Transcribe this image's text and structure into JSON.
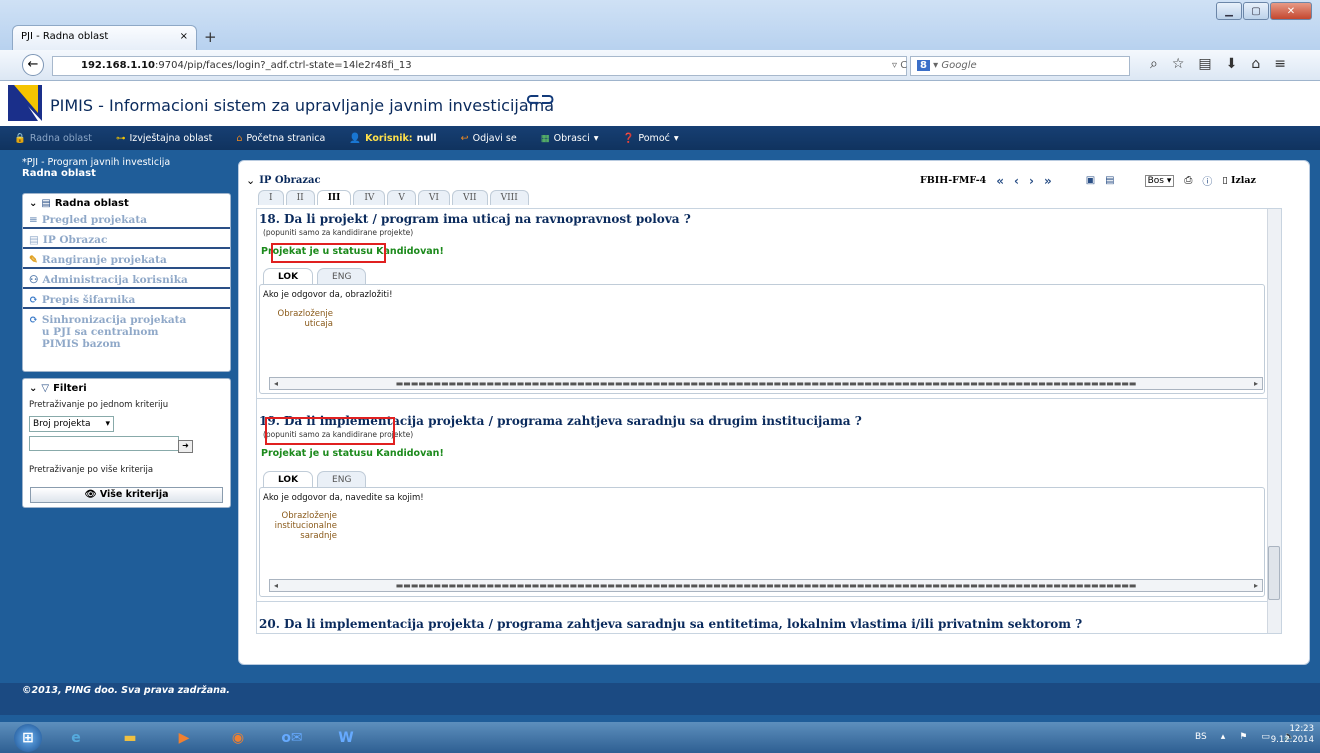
{
  "browser": {
    "tab_title": "PJI - Radna oblast",
    "tab_close": "×",
    "new_tab": "+",
    "url_host": "192.168.1.10",
    "url_rest": ":9704/pip/faces/login?_adf.ctrl-state=14le2r48fi_13",
    "search_placeholder": "Google",
    "search_engine": "8"
  },
  "app": {
    "title": "PIMIS - Informacioni sistem za upravljanje javnim investicijama"
  },
  "menu": {
    "radna": "Radna oblast",
    "izvj": "Izvještajna oblast",
    "pocetna": "Početna stranica",
    "korisnik_label": "Korisnik:",
    "korisnik_value": "null",
    "odjavi": "Odjavi se",
    "obrasci": "Obrasci",
    "pomoc": "Pomoć"
  },
  "left": {
    "crumb": "*PJI - Program javnih investicija",
    "crumb_title": "Radna oblast",
    "panel_title": "Radna oblast",
    "items": [
      "Pregled projekata",
      "IP Obrazac",
      "Rangiranje projekata",
      "Administracija korisnika",
      "Prepis šifarnika",
      "Sinhronizacija projekata u PJI sa centralnom PIMIS bazom"
    ],
    "filter_title": "Filteri",
    "filter_single": "Pretraživanje po jednom kriteriju",
    "filter_select": "Broj projekta",
    "filter_multi": "Pretraživanje po više kriterija",
    "more_btn": "Više kriterija"
  },
  "main": {
    "title": "IP Obrazac",
    "tabs": [
      "I",
      "II",
      "III",
      "IV",
      "V",
      "VI",
      "VII",
      "VIII"
    ],
    "active_tab": "III",
    "form_code": "FBIH-FMF-4",
    "lang": "Bos",
    "exit": "Izlaz",
    "questions": [
      {
        "title": "18. Da li projekt / program ima uticaj na ravnopravnost polova ?",
        "sub": "(popuniti samo za kandidirane projekte)",
        "status": "Projekat je u statusu Kandidovan!",
        "tabs": [
          "LOK",
          "ENG"
        ],
        "prompt": "Ako je odgovor da, obrazložiti!",
        "label1": "Obrazloženje",
        "label2": "uticaja"
      },
      {
        "title": "19. Da li implementacija projekta / programa zahtjeva saradnju sa drugim institucijama ?",
        "sub": "(popuniti samo za kandidirane projekte)",
        "status": "Projekat je u statusu Kandidovan!",
        "tabs": [
          "LOK",
          "ENG"
        ],
        "prompt": "Ako je odgovor da, navedite sa kojim!",
        "label1": "Obrazloženje",
        "label2": "institucionalne",
        "label3": "saradnje"
      },
      {
        "title": "20. Da li implementacija projekta / programa zahtjeva saradnju sa entitetima, lokalnim vlastima i/ili privatnim sektorom ?"
      }
    ]
  },
  "footer": {
    "copyright": "©2013, PING doo. Sva prava zadržana."
  },
  "taskbar": {
    "lang": "BS",
    "time": "12:23",
    "date": "9.12.2014"
  }
}
